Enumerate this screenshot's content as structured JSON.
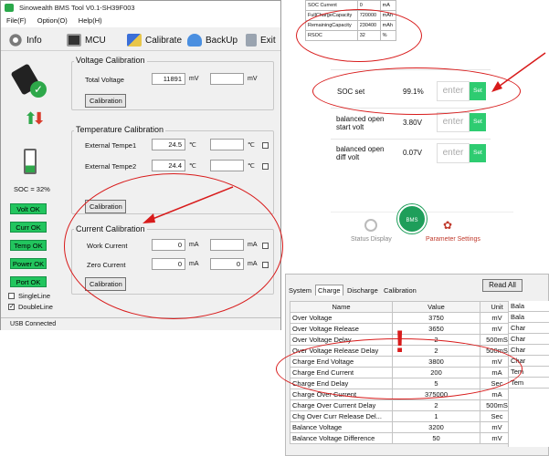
{
  "app": {
    "title": "Sinowealth BMS Tool V0.1-SH39F003",
    "menu": [
      "File(F)",
      "Option(O)",
      "Help(H)"
    ],
    "toolbar": [
      {
        "label": "Info",
        "icon": "gear-icon"
      },
      {
        "label": "MCU",
        "icon": "chip-icon"
      },
      {
        "label": "Calibrate",
        "icon": "ruler-icon"
      },
      {
        "label": "BackUp",
        "icon": "cloud-icon"
      },
      {
        "label": "Exit",
        "icon": "exit-icon"
      }
    ],
    "sidebar": {
      "soc_text": "SOC = 32%",
      "status_buttons": [
        "Volt OK",
        "Curr OK",
        "Temp OK",
        "Power OK",
        "Port OK"
      ],
      "checkboxes": [
        {
          "label": "SingleLine",
          "checked": false
        },
        {
          "label": "DoubleLine",
          "checked": true
        }
      ]
    },
    "voltage": {
      "title": "Voltage Calibration",
      "label": "Total Voltage",
      "value": "11891",
      "unit1": "mV",
      "unit2": "mV",
      "button": "Calibration"
    },
    "temperature": {
      "title": "Temperature Calibration",
      "rows": [
        {
          "label": "External Tempe1",
          "value": "24.5",
          "unit1": "℃",
          "unit2": "℃"
        },
        {
          "label": "External Tempe2",
          "value": "24.4",
          "unit1": "℃",
          "unit2": "℃"
        }
      ],
      "button": "Calibration"
    },
    "current": {
      "title": "Current Calibration",
      "rows": [
        {
          "label": "Work Current",
          "value": "0",
          "value2": "",
          "unit1": "mA",
          "unit2": "mA"
        },
        {
          "label": "Zero Current",
          "value": "0",
          "value2": "0",
          "unit1": "mA",
          "unit2": "mA"
        }
      ],
      "button": "Calibration"
    },
    "status": "USB Connected"
  },
  "mobile": {
    "small_table": [
      {
        "name": "SOC Current",
        "value": "0",
        "unit": "mA"
      },
      {
        "name": "FullChargeCapacity",
        "value": "720000",
        "unit": "mAh"
      },
      {
        "name": "RemainingCapacity",
        "value": "230400",
        "unit": "mAh"
      },
      {
        "name": "RSOC",
        "value": "32",
        "unit": "%"
      }
    ],
    "rows": [
      {
        "label": "SOC set",
        "value": "99.1%",
        "placeholder": "enter",
        "button": "Set"
      },
      {
        "label": "balanced open start volt",
        "value": "3.80V",
        "placeholder": "enter",
        "button": "Set"
      },
      {
        "label": "balanced open diff volt",
        "value": "0.07V",
        "placeholder": "enter",
        "button": "Set"
      }
    ],
    "nav": [
      {
        "label": "Status Display",
        "icon": "speedometer-icon"
      },
      {
        "label": "BMS",
        "icon": "bms-logo-icon"
      },
      {
        "label": "Parameter Settings",
        "icon": "settings-icon"
      }
    ],
    "accent": "#2ecc71",
    "nav_active": "#c0392b"
  },
  "params": {
    "tabs": [
      "System",
      "Charge",
      "Discharge",
      "Calibration"
    ],
    "active_tab": "Charge",
    "read_all": "Read All",
    "columns": [
      "Name",
      "Value",
      "Unit"
    ],
    "rows": [
      {
        "name": "Over Voltage",
        "value": "3750",
        "unit": "mV"
      },
      {
        "name": "Over Voltage Release",
        "value": "3650",
        "unit": "mV"
      },
      {
        "name": "Over Voltage Delay",
        "value": "2",
        "unit": "500mS"
      },
      {
        "name": "Over Voltage Release Delay",
        "value": "2",
        "unit": "500mS"
      },
      {
        "name": "Charge End Voltage",
        "value": "3800",
        "unit": "mV"
      },
      {
        "name": "Charge End Current",
        "value": "200",
        "unit": "mA"
      },
      {
        "name": "Charge End Delay",
        "value": "5",
        "unit": "Sec"
      },
      {
        "name": "Charge Over Current",
        "value": "375000",
        "unit": "mA"
      },
      {
        "name": "Charge Over Current Delay",
        "value": "2",
        "unit": "500mS"
      },
      {
        "name": "Chg Over Curr Release Del...",
        "value": "1",
        "unit": "Sec"
      },
      {
        "name": "Balance Voltage",
        "value": "3200",
        "unit": "mV"
      },
      {
        "name": "Balance Voltage Difference",
        "value": "50",
        "unit": "mV"
      }
    ],
    "side_cells": [
      "Bala",
      "Bala",
      "Char",
      "Char",
      "Char",
      "Char",
      "Tem",
      "Tem"
    ],
    "annotation": "!"
  },
  "colors": {
    "ok_green": "#22c55e",
    "annotation_red": "#d81b1b"
  }
}
